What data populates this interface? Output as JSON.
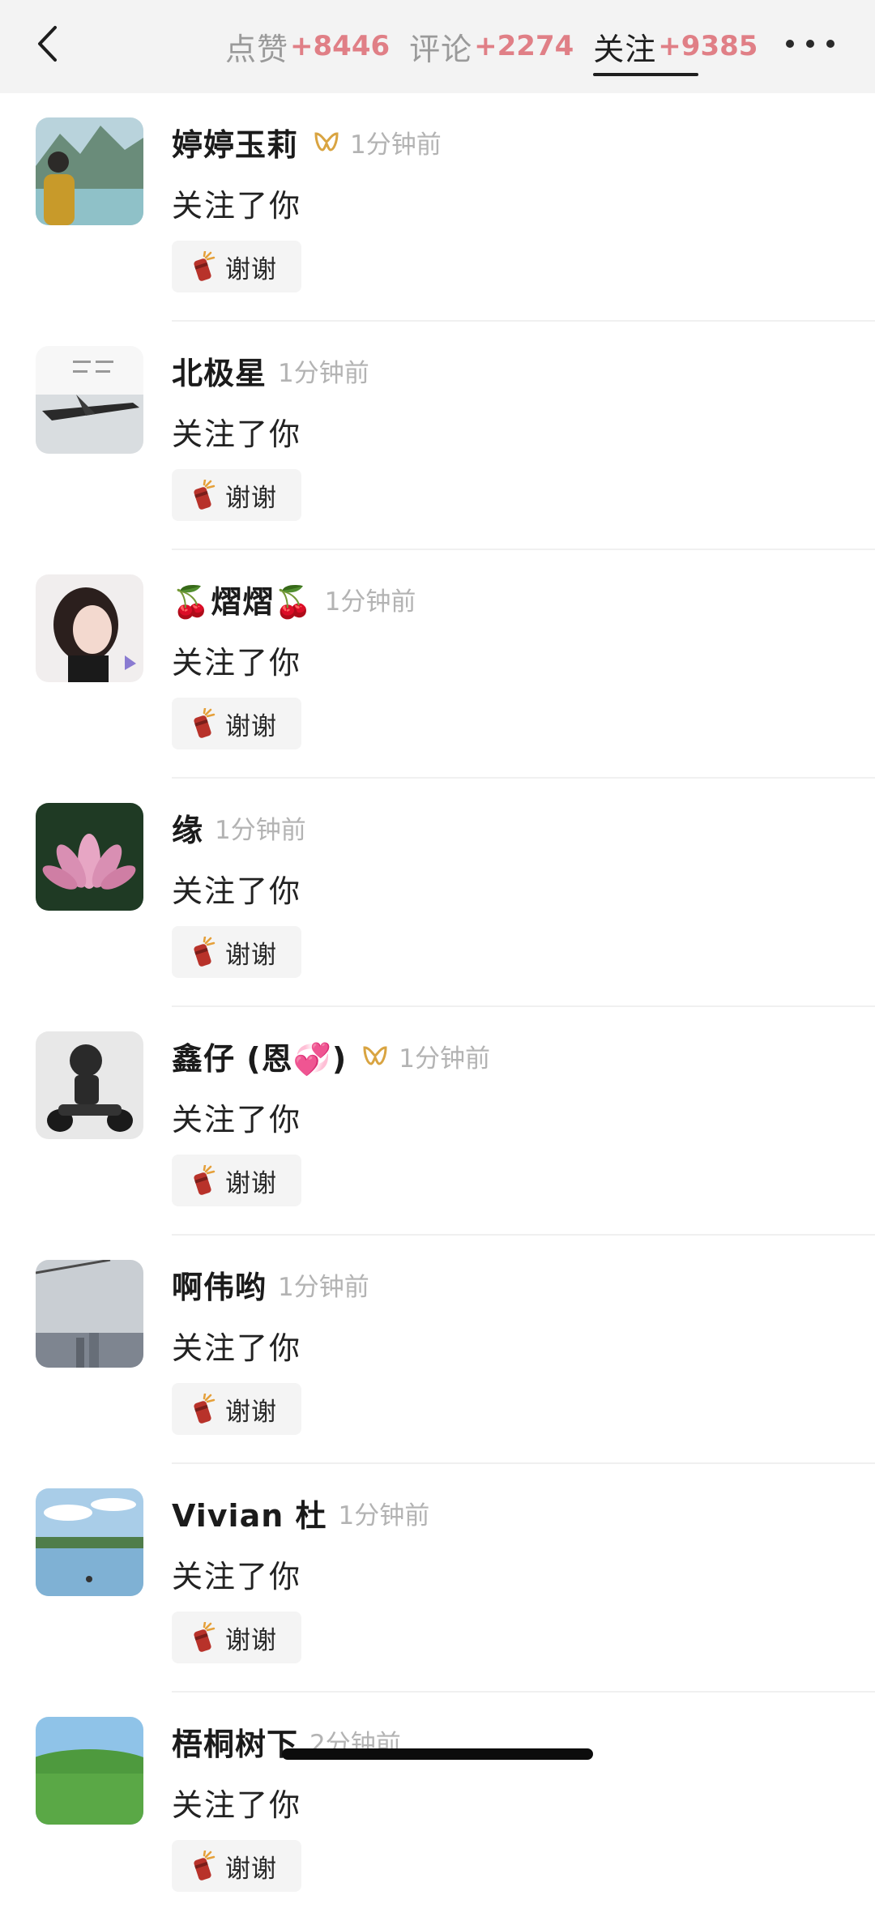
{
  "header": {
    "tabs": [
      {
        "label": "点赞",
        "count": "+8446"
      },
      {
        "label": "评论",
        "count": "+2274"
      },
      {
        "label": "关注",
        "count": "+9385"
      }
    ],
    "active_tab": "关注"
  },
  "items": [
    {
      "name": "婷婷玉莉",
      "time": "1分钟前",
      "action": "关注了你",
      "button": "谢谢"
    },
    {
      "name": "北极星",
      "time": "1分钟前",
      "action": "关注了你",
      "button": "谢谢"
    },
    {
      "name": "🍒熠熠🍒",
      "time": "1分钟前",
      "action": "关注了你",
      "button": "谢谢"
    },
    {
      "name": "缘",
      "time": "1分钟前",
      "action": "关注了你",
      "button": "谢谢"
    },
    {
      "name": "鑫仔 (恩💞)",
      "time": "1分钟前",
      "action": "关注了你",
      "button": "谢谢"
    },
    {
      "name": "啊伟哟",
      "time": "1分钟前",
      "action": "关注了你",
      "button": "谢谢"
    },
    {
      "name": "Vivian 杜",
      "time": "1分钟前",
      "action": "关注了你",
      "button": "谢谢"
    },
    {
      "name": "梧桐树下",
      "time": "2分钟前",
      "action": "关注了你",
      "button": "谢谢"
    }
  ],
  "icons": {
    "back": "chevron-left-icon",
    "more": "more-dots-icon",
    "badge": "ribbon-badge-icon",
    "thanks": "firecracker-icon"
  },
  "colors": {
    "count_accent": "#e07f86",
    "badge_gold": "#d9a441"
  }
}
